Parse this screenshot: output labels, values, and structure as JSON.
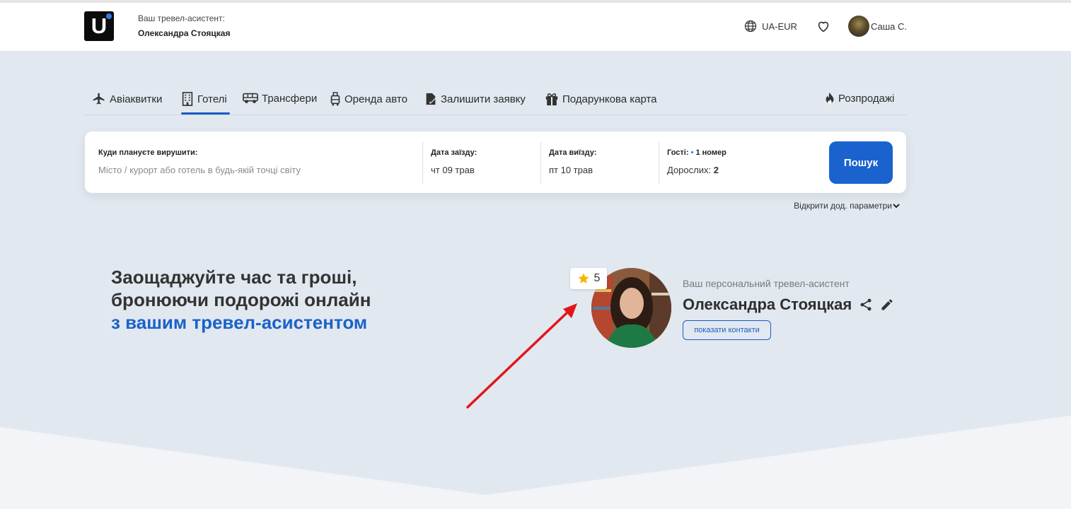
{
  "header": {
    "logo_letter": "U",
    "assistant_label": "Ваш тревел-асистент:",
    "assistant_name": "Олександра Стояцкая",
    "lang_currency": "UA-EUR",
    "user_name": "Саша С."
  },
  "tabs": [
    {
      "label": "Авіаквитки",
      "icon": "plane-icon"
    },
    {
      "label": "Готелі",
      "icon": "hotel-icon",
      "active": true
    },
    {
      "label": "Трансфери",
      "icon": "bus-icon"
    },
    {
      "label": "Оренда авто",
      "icon": "car-rental-icon"
    },
    {
      "label": "Залишити заявку",
      "icon": "request-icon"
    },
    {
      "label": "Подарункова карта",
      "icon": "gift-icon"
    },
    {
      "label": "Розпродажі",
      "icon": "fire-icon"
    }
  ],
  "search": {
    "destination_label": "Куди плануєте вирушити:",
    "destination_placeholder": "Місто / курорт або готель в будь-якій точці світу",
    "checkin_label": "Дата заїзду:",
    "checkin_value": "чт 09 трав",
    "checkout_label": "Дата виїзду:",
    "checkout_value": "пт 10 трав",
    "guests_label": "Гості:",
    "guests_rooms": "1 номер",
    "adults_label": "Дорослих:",
    "adults_value": "2",
    "button_label": "Пошук",
    "more_params": "Відкрити дод. параметри"
  },
  "hero": {
    "line1": "Заощаджуйте час та гроші,",
    "line2": "бронюючи подорожі онлайн",
    "line3": "з вашим тревел-асистентом"
  },
  "assistant": {
    "rating": "5",
    "label": "Ваш персональний тревел-асистент",
    "name": "Олександра Стояцкая",
    "contacts_button": "показати контакти"
  },
  "colors": {
    "accent": "#1a63cf",
    "page_bg": "#e1e8f0",
    "annotation_arrow": "#e4141c"
  }
}
